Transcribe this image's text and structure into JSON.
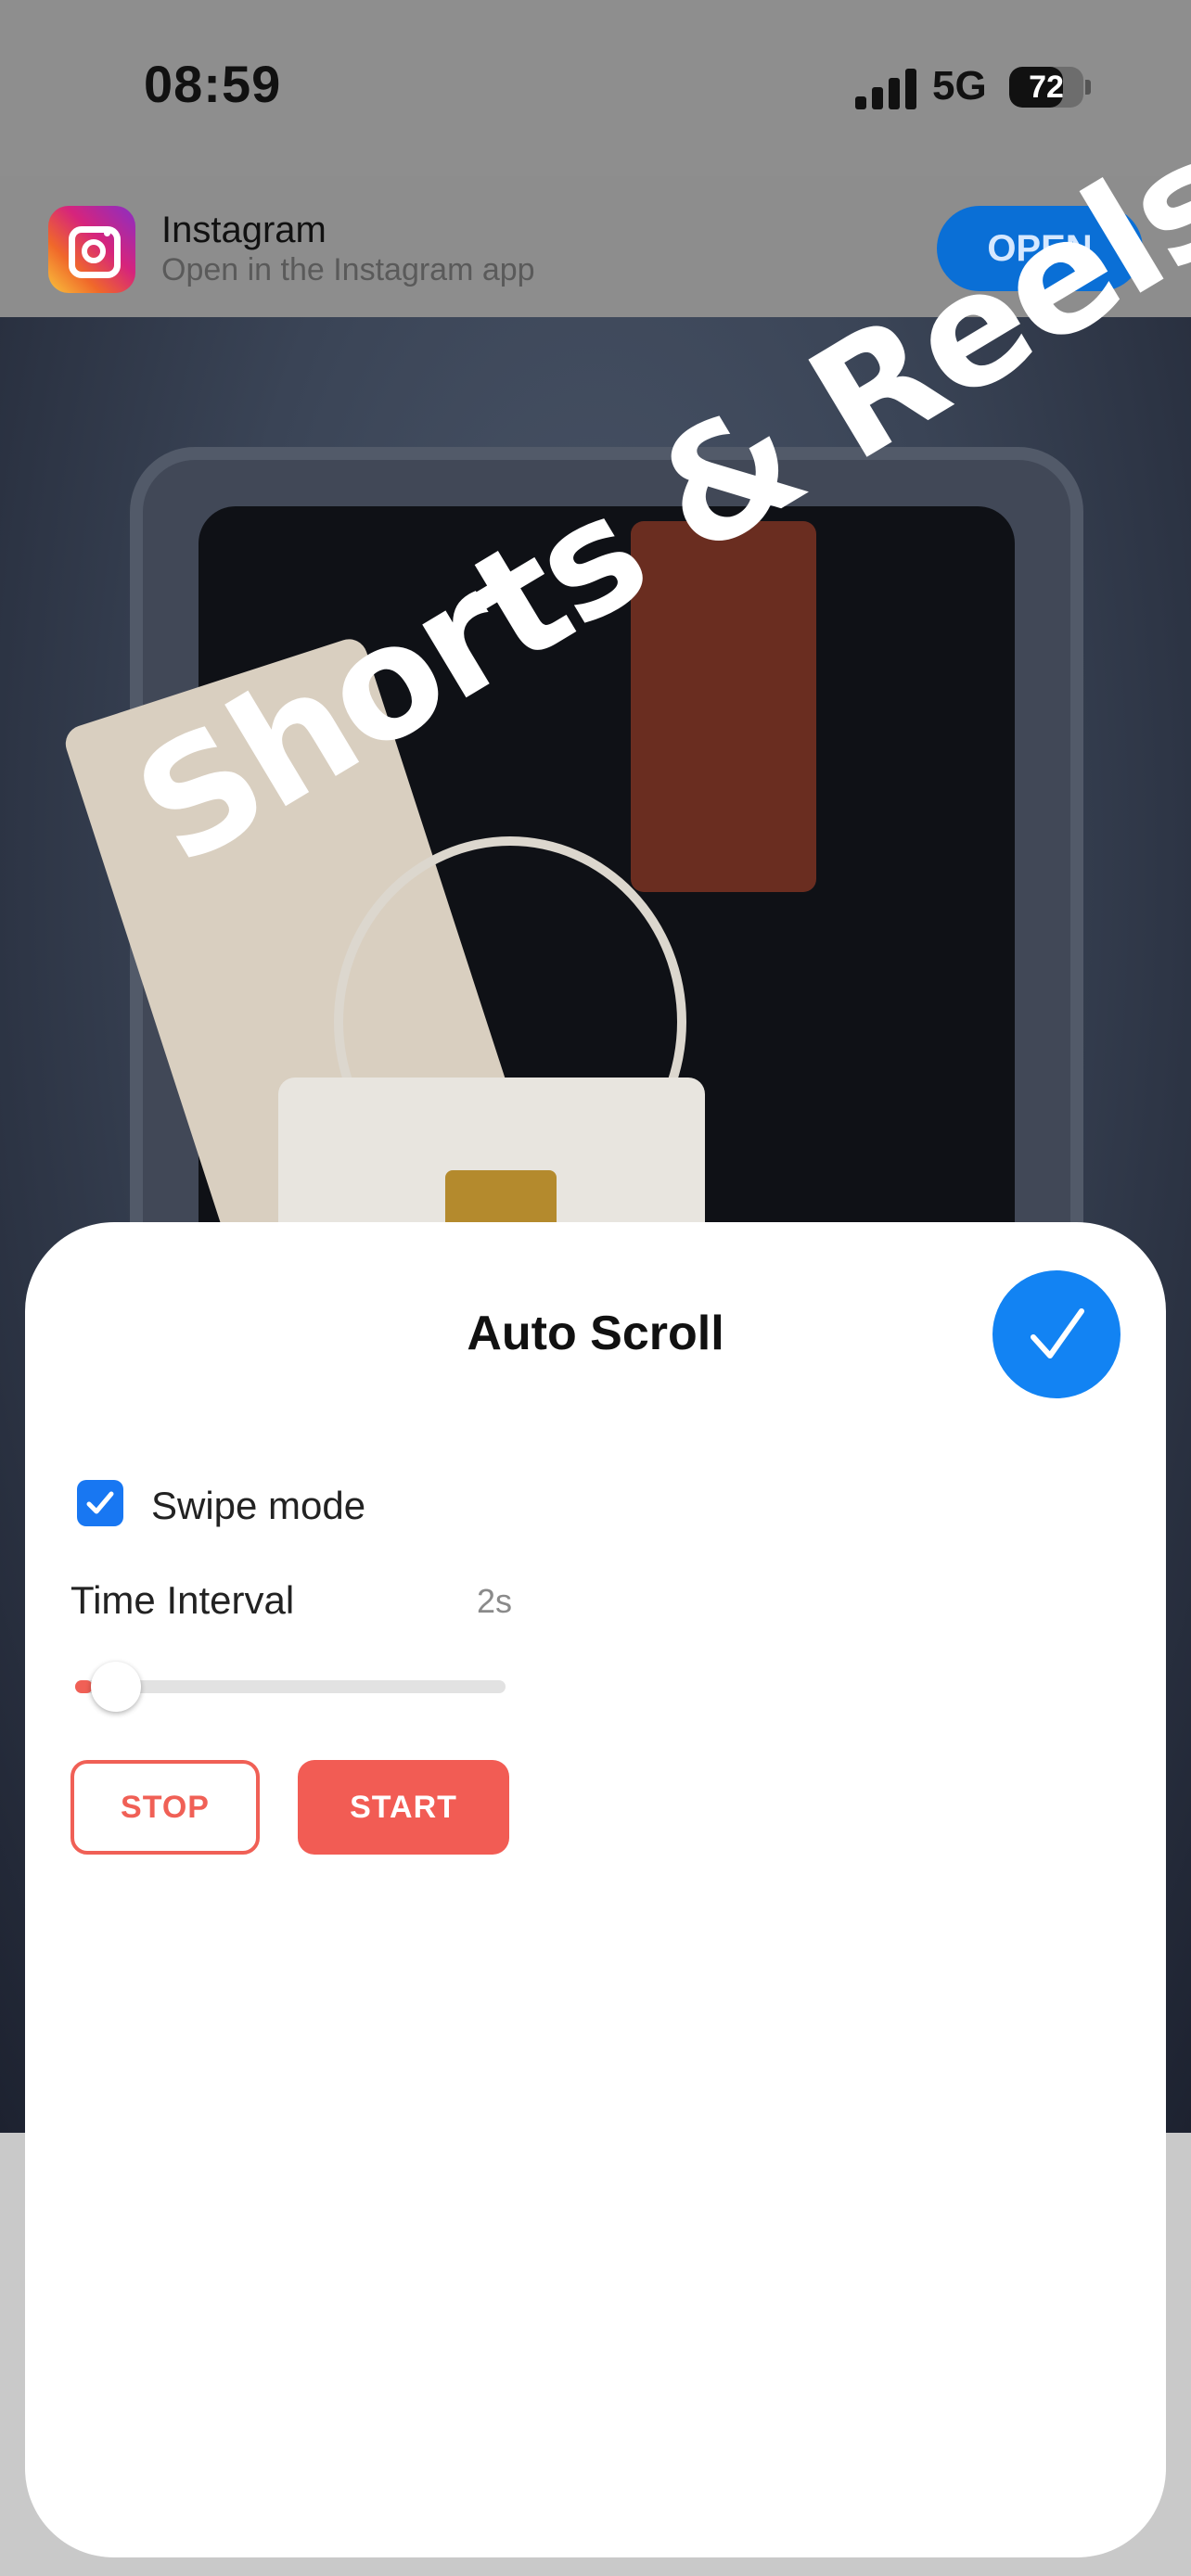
{
  "status_bar": {
    "time": "08:59",
    "network": "5G",
    "battery_level": "72",
    "battery_fraction": 0.72
  },
  "app_banner": {
    "title": "Instagram",
    "subtitle": "Open in the Instagram app",
    "open_label": "OPEN",
    "icon": "instagram-logo"
  },
  "overlay": {
    "text": "Shorts & Reels"
  },
  "auto_scroll": {
    "title": "Auto Scroll",
    "confirm_icon": "checkmark-icon",
    "swipe_mode": {
      "label": "Swipe mode",
      "checked": true
    },
    "time_interval": {
      "label": "Time Interval",
      "value": "2s",
      "slider_fraction": 0.04
    },
    "stop_label": "STOP",
    "start_label": "START"
  },
  "colors": {
    "accent_blue": "#1283f3",
    "accent_red": "#f25c54",
    "banner_button": "#0a6fd6"
  }
}
